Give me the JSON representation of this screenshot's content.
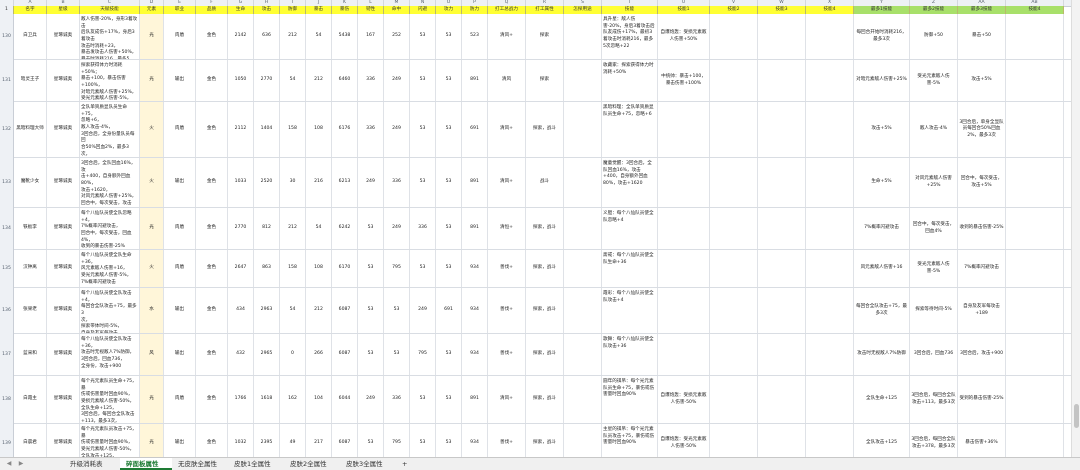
{
  "column_letters": [
    "A",
    "B",
    "C",
    "D",
    "E",
    "F",
    "G",
    "H",
    "I",
    "J",
    "K",
    "L",
    "M",
    "N",
    "O",
    "P",
    "Q",
    "R",
    "S",
    "T",
    "U",
    "V",
    "W",
    "X",
    "Y",
    "Z",
    "AA",
    "AB"
  ],
  "headers": [
    "名字",
    "星级",
    "天赋技能",
    "元素",
    "职业",
    "品质",
    "生命",
    "攻击",
    "防御",
    "暴击",
    "暴伤",
    "韧性",
    "命中",
    "闪避",
    "攻力",
    "防力",
    "打工总战力",
    "打工属性",
    "怎探用途",
    "技能",
    "技能1",
    "技能2",
    "技能3",
    "技能4",
    "最多1技能",
    "最多2技能",
    "最多3技能",
    "技能4"
  ],
  "rows": [
    {
      "num": "130",
      "cells": [
        "白卫兵",
        "星琢诚奥",
        "敌人伤害-20%，身形3着攻击\n后队友成伤+17%，身后3着攻击\n攻击时消耗+23，\n暴击发攻击人伤害+50%，\n暴击时消耗216，最多5次，\n忽略+50\n暴击+50",
        "光",
        "肉盾",
        "金色",
        "2142",
        "636",
        "212",
        "54",
        "5438",
        "167",
        "252",
        "53",
        "53",
        "523",
        "清风+",
        "探索",
        "",
        "具升星：敌人伤害-20%，身后3着攻击后队友成伤+17%，最初3着攻击时消耗216，最多5次忽略+22",
        "自爆炮轰：受损元素敌人伤害+50%",
        "",
        "",
        "",
        "每回合开始时消耗216，最多3次",
        "防御+50",
        "暴击+50",
        ""
      ]
    },
    {
      "num": "131",
      "cells": [
        "暗灵王子",
        "星琢诚奥",
        "探索获得体力时消耗+50%；\n暴击+100，暴击伤害+100%，\n对暗元素敌人伤害+25%，\n受光元素敌人伤害-5%，\n攻击+5%",
        "光",
        "输出",
        "金色",
        "1050",
        "2770",
        "54",
        "212",
        "6460",
        "336",
        "249",
        "53",
        "53",
        "891",
        "清风",
        "探索",
        "",
        "收藏家：探索获得体力时消耗+50%",
        "中统帅：暴击+100，暴击伤害+100%",
        "",
        "",
        "",
        "对暗元素敌人伤害+25%",
        "受光元素敌人伤害-5%",
        "攻击+5%",
        ""
      ]
    },
    {
      "num": "132",
      "cells": [
        "黑暗料理大师",
        "星琢诚奥",
        "全队单资质显队员生命+75，\n忽略+6，\n敌人攻击-4%，\n3回合后，全身份量队员每回\n合50%回血2%，最多3次，\n攻击+5%",
        "火",
        "肉盾",
        "金色",
        "2112",
        "1404",
        "158",
        "108",
        "6176",
        "336",
        "249",
        "53",
        "53",
        "691",
        "清风+",
        "探索，战斗",
        "",
        "黑暗料理：全队单资质显队员生命+75，忽略+6",
        "",
        "",
        "",
        "",
        "攻击+5%",
        "敌人攻击-4%",
        "3回合后，单身全显队员每回合50%回血2%，最多3次",
        ""
      ]
    },
    {
      "num": "133",
      "cells": [
        "魔靴少女",
        "星琢诚奥",
        "3回合后，全队回血16%，攻\n击+400，自身额外回血80%，\n攻击+1620，\n对风元素敌人伤害+25%，\n回合中，每次受击，攻击\n+5%\n暴击+5%",
        "火",
        "输出",
        "金色",
        "1033",
        "2520",
        "30",
        "216",
        "6213",
        "249",
        "336",
        "53",
        "53",
        "891",
        "清风+",
        "战斗",
        "",
        "魔童觉醒：3回合后，全队回血16%，攻击+400，自身额外回血80%，攻击+1620",
        "",
        "",
        "",
        "",
        "生命+5%",
        "对风元素敌人伤害+25%",
        "回合中，每次受击，攻击+5%",
        ""
      ]
    },
    {
      "num": "134",
      "cells": [
        "铁板李",
        "星琢诚奥",
        "每个八仙队员使全队忽略\n+4，\n7%概率闪避攻击，\n回合中，每次受击，回血\n4%，\n收到的暴击伤害-25%",
        "光",
        "肉盾",
        "金色",
        "2770",
        "812",
        "212",
        "54",
        "6242",
        "53",
        "249",
        "336",
        "53",
        "891",
        "清恒+",
        "探索，战斗",
        "",
        "义胆：每个八仙队员使全队忽略+4",
        "",
        "",
        "",
        "",
        "7%概率闪避攻击",
        "回合中，每次受击，回血4%",
        "收到的暴击伤害-25%",
        ""
      ]
    },
    {
      "num": "135",
      "cells": [
        "汉钟离",
        "星琢诚奥",
        "每个八仙队员使全队生命\n+36，\n风元素敌人伤害+16，\n受光元素敌人伤害-5%，\n7%概率闪避攻击",
        "火",
        "肉盾",
        "金色",
        "2647",
        "863",
        "158",
        "108",
        "6170",
        "53",
        "795",
        "53",
        "53",
        "934",
        "善伐+",
        "探索，战斗",
        "",
        "斋戒：每个八仙队员使全队生命+36",
        "",
        "",
        "",
        "",
        "风元素敌人伤害+16",
        "受光元素敌人伤害-5%",
        "7%概率闪避攻击",
        ""
      ]
    },
    {
      "num": "136",
      "cells": [
        "张果老",
        "星琢诚奥",
        "每个八仙队员使全队攻击\n+4，\n每回合全队攻击+75，最多3\n次，\n探索带体时间-5%，\n自身及友军每攻击\n+189",
        "水",
        "输出",
        "金色",
        "434",
        "2963",
        "54",
        "212",
        "6087",
        "53",
        "53",
        "249",
        "691",
        "934",
        "善伐+",
        "探索，战斗",
        "",
        "霞彩：每个八仙队员使全队攻击+4",
        "",
        "",
        "",
        "",
        "每回合全队攻击+75，最多3次",
        "探索等待时间-5%",
        "自身及友军每攻击+189",
        ""
      ]
    },
    {
      "num": "137",
      "cells": [
        "蓝采和",
        "星琢诚奥",
        "每个八仙队员使全队攻击\n+36，\n攻击时无视敌人7%防御，\n3回合后，回血736，\n全身份，攻击+900",
        "风",
        "输出",
        "金色",
        "432",
        "2965",
        "0",
        "266",
        "6087",
        "53",
        "53",
        "795",
        "53",
        "934",
        "善伐+",
        "探索，战斗",
        "",
        "歌舞：每个八仙队员使全队攻击+36",
        "",
        "",
        "",
        "",
        "攻击时无视敌人7%防御",
        "3回合后，回血736",
        "3回合后，攻击+900",
        ""
      ]
    },
    {
      "num": "138",
      "cells": [
        "白霞主",
        "星琢诚奥",
        "每个光元素队员生命+75，暴\n伤或伤害量时回血90%，\n受损元素敌人伤害-50%，\n全队生命+125，\n3回合后，每回合全队攻击\n+113，最多3次，\n受到的暴击伤害-25%",
        "光",
        "肉盾",
        "金色",
        "1766",
        "1618",
        "162",
        "104",
        "6044",
        "249",
        "336",
        "53",
        "53",
        "891",
        "清风+",
        "探索，战斗",
        "",
        "圆年的祺吊：每个光元素队员生命+75，暴伤或伤害量时回血90%",
        "自爆炮轰：受损元素敌人伤害-50%",
        "",
        "",
        "",
        "全队生命+125",
        "3回合后，每回合全队攻击+113，最多3次",
        "受到的暴击伤害-25%",
        ""
      ]
    },
    {
      "num": "139",
      "cells": [
        "白晨君",
        "星琢诚奥",
        "每个光元素队员攻击+75，暴\n伤或伤害量时回血90%，\n受光元素敌人伤害-50%，\n全队攻击+125，\n3回合后，每回合全队攻击\n+378，最多3次",
        "光",
        "输出",
        "金色",
        "1032",
        "2395",
        "49",
        "217",
        "6087",
        "53",
        "795",
        "53",
        "53",
        "934",
        "善伐+",
        "探索，战斗",
        "",
        "主星的祺吊：每个光元素队员攻击+75，暴伤或伤害量时回血90%",
        "自爆炮轰：受光元素敌人伤害-50%",
        "",
        "",
        "",
        "全队攻击+125",
        "3回合后，每回合全队攻击+378，最多3次",
        "暴击伤害+36%",
        ""
      ]
    }
  ],
  "tabs": [
    "升级消耗表",
    "碎面板属性",
    "无皮肤全属性",
    "皮肤1全属性",
    "皮肤2全属性",
    "皮肤3全属性"
  ],
  "active_tab": "碎面板属性",
  "add_tab": "+",
  "nav_prev": "◀",
  "nav_next": "▶"
}
